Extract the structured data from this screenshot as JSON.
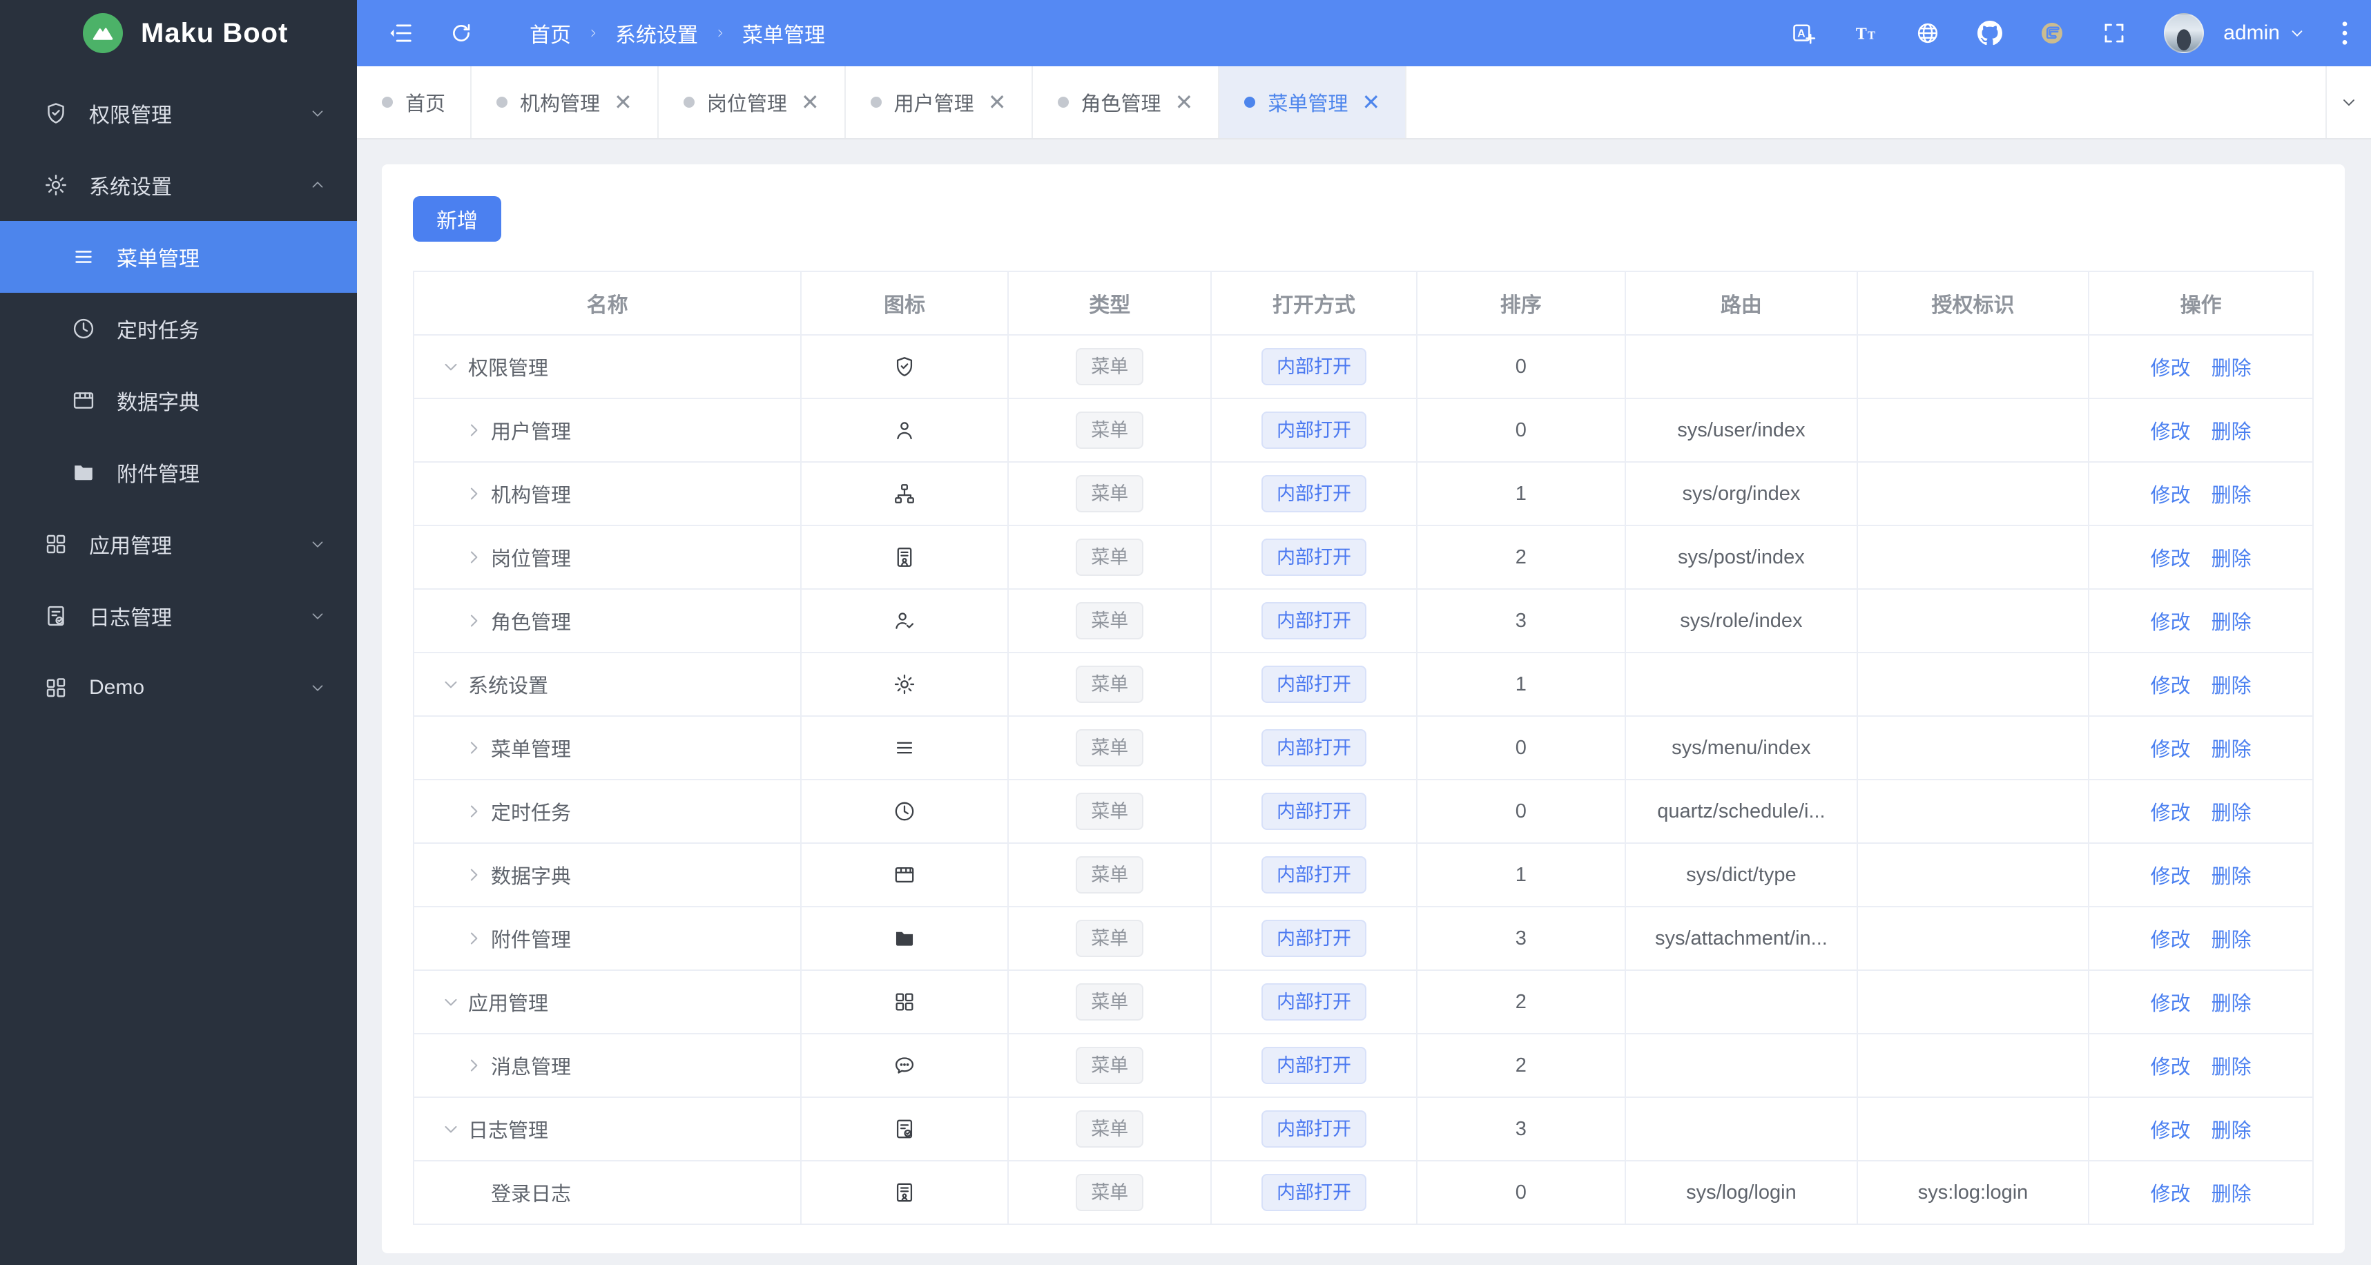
{
  "app": {
    "logo_text": "Maku Boot"
  },
  "colors": {
    "accent": "#4b80f0",
    "header_blue": "#5589f3",
    "sidebar_bg": "#29313d",
    "sidebar_active": "#4d85ec",
    "tag_blue_text": "#4a78f0",
    "logo_green": "#4cb268"
  },
  "sidebar": {
    "items": [
      {
        "label": "权限管理",
        "icon": "shield-check",
        "level": 0,
        "state": "collapsed",
        "active": false
      },
      {
        "label": "系统设置",
        "icon": "gear",
        "level": 0,
        "state": "expanded",
        "active": false
      },
      {
        "label": "菜单管理",
        "icon": "menu",
        "level": 1,
        "state": "none",
        "active": true
      },
      {
        "label": "定时任务",
        "icon": "clock",
        "level": 1,
        "state": "none",
        "active": false
      },
      {
        "label": "数据字典",
        "icon": "dict-table",
        "level": 1,
        "state": "none",
        "active": false
      },
      {
        "label": "附件管理",
        "icon": "folder",
        "level": 1,
        "state": "none",
        "active": false
      },
      {
        "label": "应用管理",
        "icon": "app-grid",
        "level": 0,
        "state": "collapsed",
        "active": false
      },
      {
        "label": "日志管理",
        "icon": "log-doc",
        "level": 0,
        "state": "collapsed",
        "active": false
      },
      {
        "label": "Demo",
        "icon": "demo-grid",
        "level": 0,
        "state": "collapsed",
        "active": false
      }
    ]
  },
  "topbar": {
    "breadcrumb": [
      "首页",
      "系统设置",
      "菜单管理"
    ],
    "icons": [
      "translate-icon",
      "font-size-icon",
      "globe-icon",
      "github-icon",
      "gitee-icon",
      "fullscreen-icon"
    ],
    "username": "admin"
  },
  "tabs": [
    {
      "label": "首页",
      "closable": false,
      "active": false
    },
    {
      "label": "机构管理",
      "closable": true,
      "active": false
    },
    {
      "label": "岗位管理",
      "closable": true,
      "active": false
    },
    {
      "label": "用户管理",
      "closable": true,
      "active": false
    },
    {
      "label": "角色管理",
      "closable": true,
      "active": false
    },
    {
      "label": "菜单管理",
      "closable": true,
      "active": true
    }
  ],
  "content": {
    "add_button": "新增",
    "table": {
      "columns": [
        "名称",
        "图标",
        "类型",
        "打开方式",
        "排序",
        "路由",
        "授权标识",
        "操作"
      ],
      "actions": [
        "修改",
        "删除"
      ],
      "rows": [
        {
          "name": "权限管理",
          "level": 0,
          "expand": "down",
          "icon": "shield-check",
          "type": "菜单",
          "open": "内部打开",
          "sort": "0",
          "route": "",
          "auth": ""
        },
        {
          "name": "用户管理",
          "level": 1,
          "expand": "right",
          "icon": "user",
          "type": "菜单",
          "open": "内部打开",
          "sort": "0",
          "route": "sys/user/index",
          "auth": ""
        },
        {
          "name": "机构管理",
          "level": 1,
          "expand": "right",
          "icon": "org-tree",
          "type": "菜单",
          "open": "内部打开",
          "sort": "1",
          "route": "sys/org/index",
          "auth": ""
        },
        {
          "name": "岗位管理",
          "level": 1,
          "expand": "right",
          "icon": "id-card",
          "type": "菜单",
          "open": "内部打开",
          "sort": "2",
          "route": "sys/post/index",
          "auth": ""
        },
        {
          "name": "角色管理",
          "level": 1,
          "expand": "right",
          "icon": "user-check",
          "type": "菜单",
          "open": "内部打开",
          "sort": "3",
          "route": "sys/role/index",
          "auth": ""
        },
        {
          "name": "系统设置",
          "level": 0,
          "expand": "down",
          "icon": "gear",
          "type": "菜单",
          "open": "内部打开",
          "sort": "1",
          "route": "",
          "auth": ""
        },
        {
          "name": "菜单管理",
          "level": 1,
          "expand": "right",
          "icon": "menu",
          "type": "菜单",
          "open": "内部打开",
          "sort": "0",
          "route": "sys/menu/index",
          "auth": ""
        },
        {
          "name": "定时任务",
          "level": 1,
          "expand": "right",
          "icon": "clock",
          "type": "菜单",
          "open": "内部打开",
          "sort": "0",
          "route": "quartz/schedule/i...",
          "auth": ""
        },
        {
          "name": "数据字典",
          "level": 1,
          "expand": "right",
          "icon": "dict-table",
          "type": "菜单",
          "open": "内部打开",
          "sort": "1",
          "route": "sys/dict/type",
          "auth": ""
        },
        {
          "name": "附件管理",
          "level": 1,
          "expand": "right",
          "icon": "folder",
          "type": "菜单",
          "open": "内部打开",
          "sort": "3",
          "route": "sys/attachment/in...",
          "auth": ""
        },
        {
          "name": "应用管理",
          "level": 0,
          "expand": "down",
          "icon": "app-grid",
          "type": "菜单",
          "open": "内部打开",
          "sort": "2",
          "route": "",
          "auth": ""
        },
        {
          "name": "消息管理",
          "level": 1,
          "expand": "right",
          "icon": "chat",
          "type": "菜单",
          "open": "内部打开",
          "sort": "2",
          "route": "",
          "auth": ""
        },
        {
          "name": "日志管理",
          "level": 0,
          "expand": "down",
          "icon": "log-doc",
          "type": "菜单",
          "open": "内部打开",
          "sort": "3",
          "route": "",
          "auth": ""
        },
        {
          "name": "登录日志",
          "level": 1,
          "expand": "none",
          "icon": "login-log",
          "type": "菜单",
          "open": "内部打开",
          "sort": "0",
          "route": "sys/log/login",
          "auth": "sys:log:login"
        }
      ]
    }
  }
}
